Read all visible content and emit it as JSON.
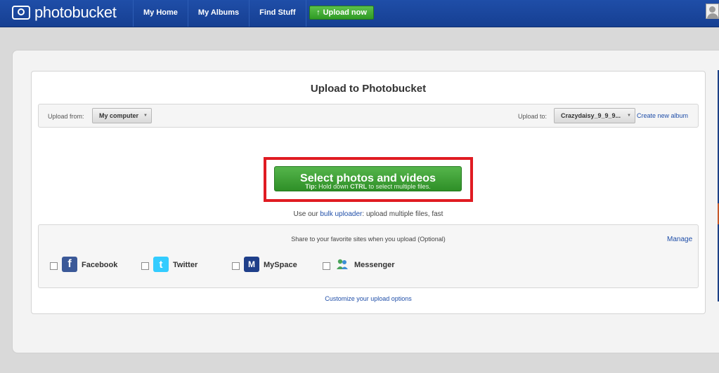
{
  "header": {
    "logo_text": "photobucket",
    "nav": [
      "My Home",
      "My Albums",
      "Find Stuff"
    ],
    "upload_button": "Upload now",
    "upload_icon": "↑"
  },
  "upload": {
    "title": "Upload to Photobucket",
    "from_label": "Upload from:",
    "from_value": "My computer",
    "to_label": "Upload to:",
    "to_value": "Crazydaisy_9_9_9...",
    "create_album": "Create new album",
    "select_button": "Select photos and videos",
    "tip_prefix": "Tip:",
    "tip_text": " Hold down ",
    "tip_key": "CTRL",
    "tip_suffix": " to select multiple files.",
    "bulk_prefix": "Use our ",
    "bulk_link": "bulk uploader",
    "bulk_suffix": ": upload multiple files, fast"
  },
  "share": {
    "text": "Share to your favorite sites when you upload (Optional)",
    "manage": "Manage",
    "sites": [
      {
        "name": "Facebook",
        "icon": "f",
        "color": "#3b5998"
      },
      {
        "name": "Twitter",
        "icon": "t",
        "color": "#33ccff"
      },
      {
        "name": "MySpace",
        "icon": "M",
        "color": "#1f3f8a"
      },
      {
        "name": "Messenger",
        "icon": "",
        "color": "#5ea66b"
      }
    ],
    "customize": "Customize your upload options"
  },
  "colors": {
    "nav_bg": "#1f4ea8",
    "green_button": "#3aa332",
    "highlight": "#e01b22"
  }
}
